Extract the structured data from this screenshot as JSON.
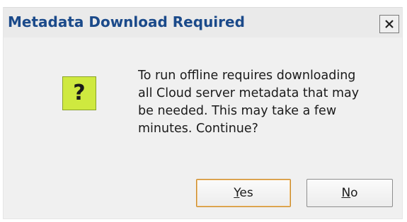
{
  "window": {
    "title": "Metadata Download Required",
    "close_label": "Close"
  },
  "icon": {
    "name": "question-icon",
    "glyph": "?",
    "color": "#cfe93f"
  },
  "message": {
    "lines": [
      "To run offline requires downloading",
      "all Cloud server metadata that may",
      "be needed. This may take a few",
      "minutes. Continue?"
    ]
  },
  "buttons": {
    "yes_label": "Yes",
    "no_label": "No",
    "default_accent": "#c98a2a"
  }
}
